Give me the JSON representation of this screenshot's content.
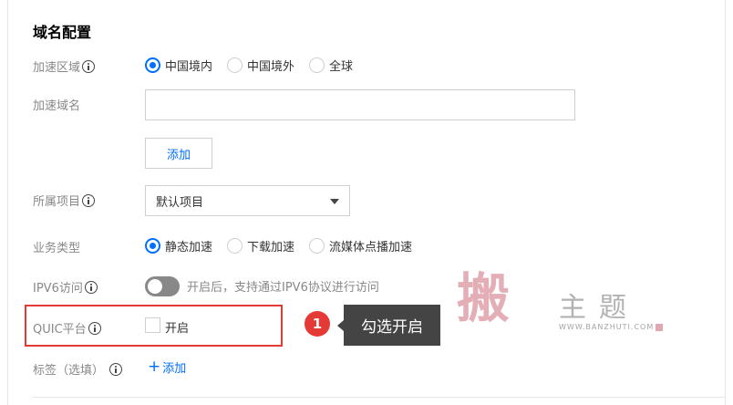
{
  "section": {
    "title": "域名配置"
  },
  "region": {
    "label": "加速区域",
    "options": [
      "中国境内",
      "中国境外",
      "全球"
    ],
    "selected": "中国境内"
  },
  "domain": {
    "label": "加速域名",
    "value": "",
    "add_label": "添加"
  },
  "project": {
    "label": "所属项目",
    "value": "默认项目"
  },
  "business": {
    "label": "业务类型",
    "options": [
      "静态加速",
      "下载加速",
      "流媒体点播加速"
    ],
    "selected": "静态加速"
  },
  "ipv6": {
    "label": "IPV6访问",
    "hint": "开启后，支持通过IPV6协议进行访问",
    "enabled": false
  },
  "quic": {
    "label": "QUIC平台",
    "checkbox_label": "开启",
    "checked": false
  },
  "tags": {
    "label": "标签（选填）",
    "add_label": "添加"
  },
  "annotation": {
    "number": "1",
    "text": "勾选开启"
  },
  "watermark": {
    "big": "搬",
    "small": "主题",
    "url": "WWW.BANZHUTI.COM"
  },
  "colors": {
    "primary": "#006eff",
    "annotation_red": "#e53935",
    "toggle_off": "#888888",
    "callout_bg": "#444444"
  }
}
